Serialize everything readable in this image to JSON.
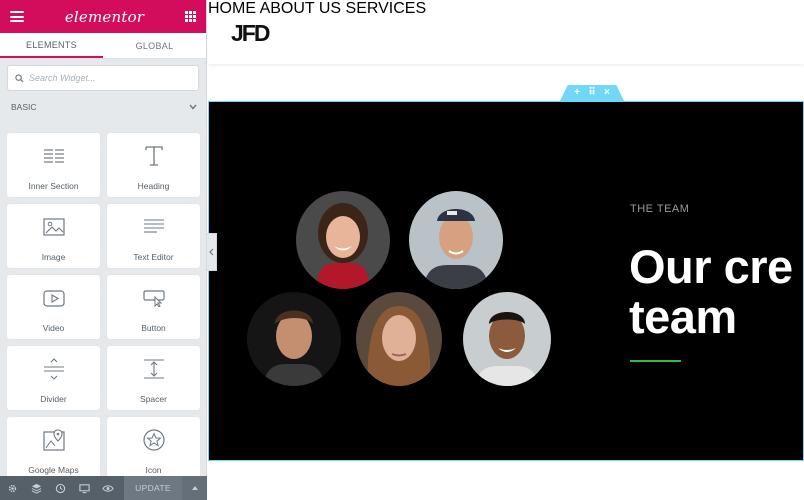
{
  "panel": {
    "logo": "elementor",
    "tabs": [
      {
        "label": "ELEMENTS",
        "active": true
      },
      {
        "label": "GLOBAL",
        "active": false
      }
    ],
    "search_placeholder": "Search Widget...",
    "category": "BASIC",
    "widgets": [
      {
        "label": "Inner Section",
        "icon": "columns-icon"
      },
      {
        "label": "Heading",
        "icon": "heading-icon"
      },
      {
        "label": "Image",
        "icon": "image-icon"
      },
      {
        "label": "Text Editor",
        "icon": "text-editor-icon"
      },
      {
        "label": "Video",
        "icon": "video-icon"
      },
      {
        "label": "Button",
        "icon": "button-icon"
      },
      {
        "label": "Divider",
        "icon": "divider-icon"
      },
      {
        "label": "Spacer",
        "icon": "spacer-icon"
      },
      {
        "label": "Google Maps",
        "icon": "map-icon"
      },
      {
        "label": "Icon",
        "icon": "star-icon"
      }
    ],
    "footer": {
      "tools": [
        "settings-icon",
        "navigator-icon",
        "history-icon",
        "responsive-icon",
        "preview-eye-icon"
      ],
      "update_label": "UPDATE"
    },
    "accent_color": "#d30c5c"
  },
  "site": {
    "logo": "JFD",
    "nav": [
      "HOME",
      "ABOUT US",
      "SERVICES"
    ],
    "section_handle": [
      "+",
      "⠿",
      "×"
    ],
    "team_label": "THE TEAM",
    "headline_line1": "Our cre",
    "headline_line2": "team",
    "accent_line_color": "#39b54a",
    "selection_color": "#71d7f7"
  }
}
